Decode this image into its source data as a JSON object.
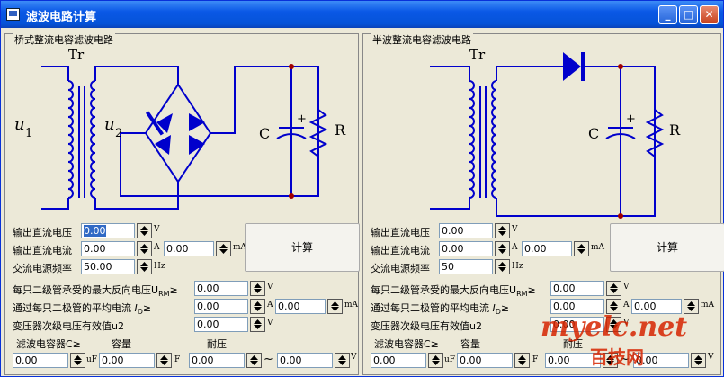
{
  "window": {
    "title": "滤波电路计算",
    "min": "_",
    "max": "□",
    "close": "✕"
  },
  "left": {
    "group_title": "桥式整流电容滤波电路",
    "diagram": {
      "tr": "Tr",
      "u1": "u",
      "u1sub": "1",
      "u2": "u",
      "u2sub": "2",
      "c": "C",
      "r": "R",
      "plus": "+"
    },
    "out_dc_voltage": {
      "label": "输出直流电压",
      "value": "0.00",
      "unit": "V"
    },
    "out_dc_current": {
      "label": "输出直流电流",
      "value": "0.00",
      "unit": "A",
      "value2": "0.00",
      "unit2": "mA"
    },
    "ac_freq": {
      "label": "交流电源频率",
      "value": "50.00",
      "unit": "Hz"
    },
    "calc": "计算",
    "max_reverse": {
      "label": "每只二级管承受的最大反向电压",
      "sym": "U",
      "sub": "RM",
      "ge": "≥",
      "value": "0.00",
      "unit": "V"
    },
    "avg_current": {
      "label": "通过每只二极管的平均电流",
      "sym": "I",
      "sub": "D",
      "ge": "≥",
      "value": "0.00",
      "unit": "A",
      "value2": "0.00",
      "unit2": "mA"
    },
    "secondary": {
      "label": "变压器次级电压有效值u2",
      "value": "0.00",
      "unit": "V"
    },
    "cap_row": {
      "label1": "滤波电容器C≥",
      "label2": "容量",
      "label3": "耐压",
      "v1": "0.00",
      "u1": "uF",
      "v2": "0.00",
      "u2": "F",
      "v3": "0.00",
      "tilde": "~",
      "v4": "0.00",
      "u4": "V"
    }
  },
  "right": {
    "group_title": "半波整流电容滤波电路",
    "diagram": {
      "tr": "Tr",
      "c": "C",
      "r": "R",
      "plus": "+"
    },
    "out_dc_voltage": {
      "label": "输出直流电压",
      "value": "0.00",
      "unit": "V"
    },
    "out_dc_current": {
      "label": "输出直流电流",
      "value": "0.00",
      "unit": "A",
      "value2": "0.00",
      "unit2": "mA"
    },
    "ac_freq": {
      "label": "交流电源频率",
      "value": "50",
      "unit": "Hz"
    },
    "calc": "计算",
    "max_reverse": {
      "label": "每只二级管承受的最大反向电压",
      "sym": "U",
      "sub": "RM",
      "ge": "≥",
      "value": "0.00",
      "unit": "V"
    },
    "avg_current": {
      "label": "通过每只二极管的平均电流",
      "sym": "I",
      "sub": "D",
      "ge": "≥",
      "value": "0.00",
      "unit": "A",
      "value2": "0.00",
      "unit2": "mA"
    },
    "secondary": {
      "label": "变压器次级电压有效值u2",
      "value": "0.00",
      "unit": "V"
    },
    "cap_row": {
      "label1": "滤波电容器C≥",
      "label2": "容量",
      "label3": "耐压",
      "v1": "0.00",
      "u1": "uF",
      "v2": "0.00",
      "u2": "F",
      "v3": "0.00",
      "tilde": "~",
      "v4": "0.00",
      "u4": "V"
    }
  },
  "watermark": {
    "line1": "myelc.net",
    "line2": "百技网"
  },
  "colors": {
    "wire": "#0000cc",
    "node": "#a00000",
    "titlebar": "#0a58e6"
  }
}
